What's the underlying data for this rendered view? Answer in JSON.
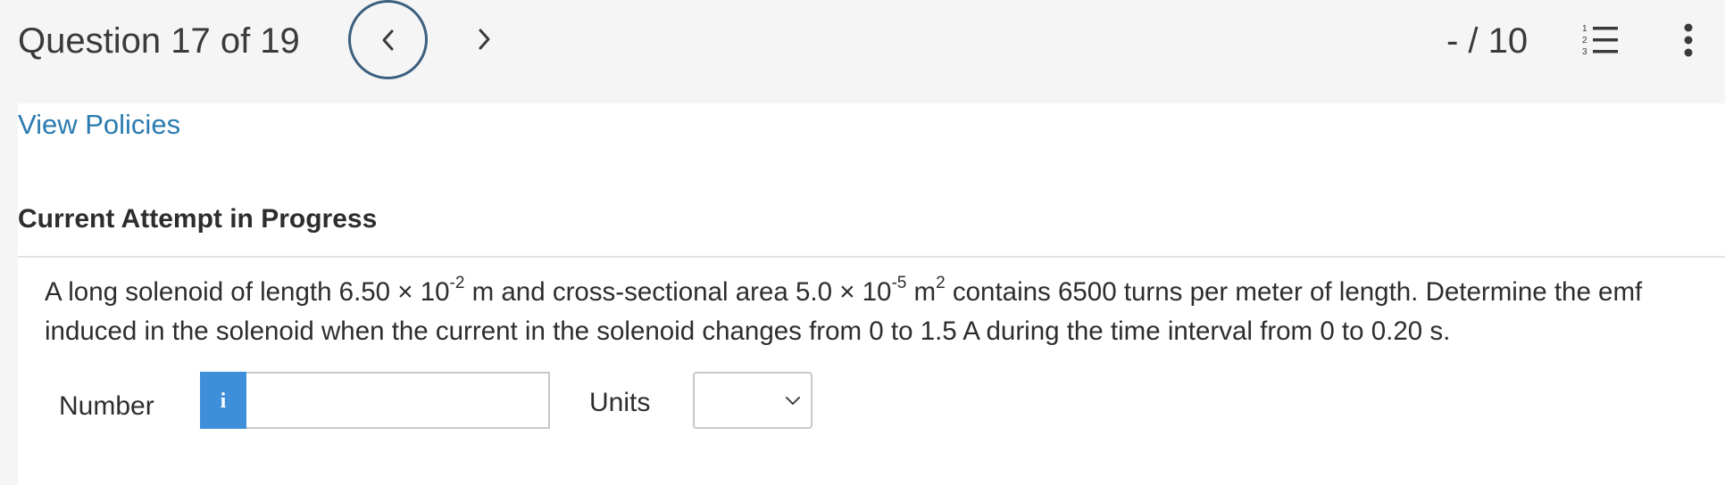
{
  "header": {
    "question_counter": "Question 17 of 19",
    "score": "- / 10",
    "prev_icon": "chevron-left-icon",
    "next_icon": "chevron-right-icon",
    "list_icon": "numbered-list-icon",
    "list_icon_digits": [
      "1",
      "2",
      "3"
    ],
    "more_icon": "vertical-ellipsis-icon",
    "accent_color": "#3a5f7e"
  },
  "links": {
    "view_policies": "View Policies",
    "link_color": "#2b7bb0"
  },
  "attempt": {
    "heading": "Current Attempt in Progress"
  },
  "question": {
    "part1": "A long solenoid of length 6.50 × 10",
    "exp1": "-2",
    "part2": " m and cross-sectional area 5.0 × 10",
    "exp2": "-5",
    "part3": " m",
    "exp3": "2",
    "part4": " contains 6500 turns per meter of length. Determine the emf induced in the solenoid when the current in the solenoid changes from 0 to 1.5 A during the time interval from 0 to 0.20 s."
  },
  "answer": {
    "number_label": "Number",
    "info_glyph": "i",
    "info_icon": "info-icon",
    "info_color": "#3f8ed9",
    "number_value": "",
    "units_label": "Units",
    "units_selected": ""
  }
}
